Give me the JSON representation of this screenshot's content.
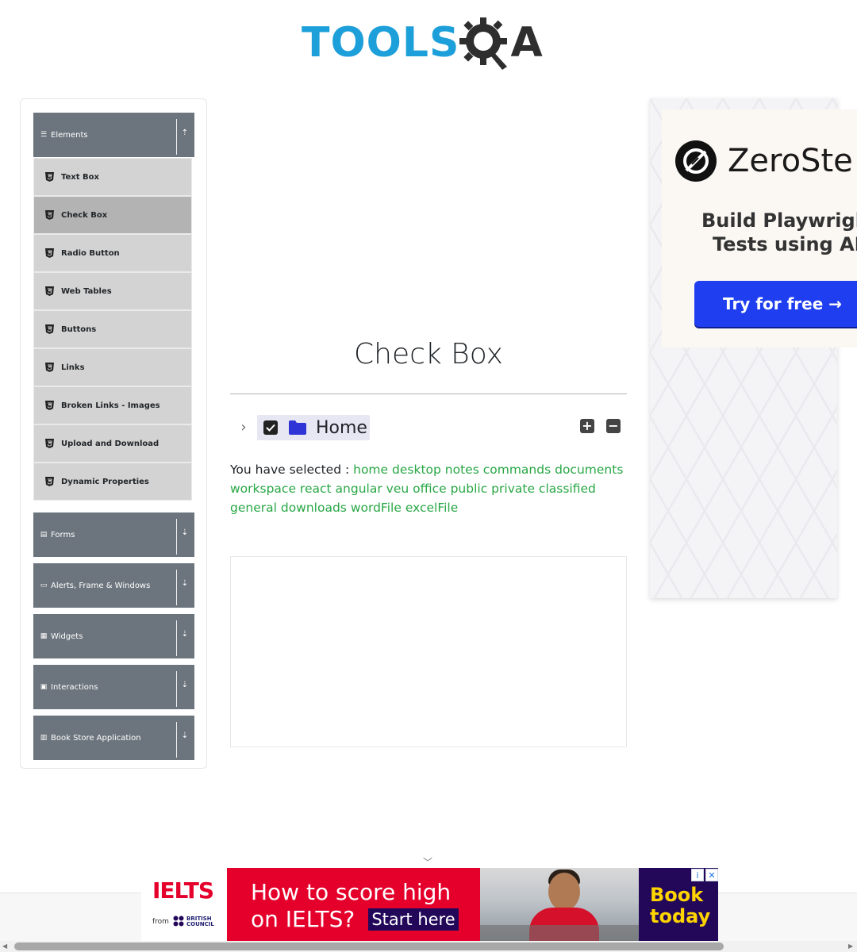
{
  "header": {
    "logo_text": "TOOLSQA",
    "logo_part1": "TOOLS",
    "logo_part2": "A"
  },
  "sidebar": {
    "groups": [
      {
        "label": "Elements",
        "icon": "hamburger-icon",
        "expanded": true
      },
      {
        "label": "Forms",
        "icon": "form-icon",
        "expanded": false
      },
      {
        "label": "Alerts, Frame & Windows",
        "icon": "window-icon",
        "expanded": false
      },
      {
        "label": "Widgets",
        "icon": "widgets-icon",
        "expanded": false
      },
      {
        "label": "Interactions",
        "icon": "interactions-icon",
        "expanded": false
      },
      {
        "label": "Book Store Application",
        "icon": "bookstore-icon",
        "expanded": false
      }
    ],
    "elements_items": [
      {
        "label": "Text Box",
        "active": false
      },
      {
        "label": "Check Box",
        "active": true
      },
      {
        "label": "Radio Button",
        "active": false
      },
      {
        "label": "Web Tables",
        "active": false
      },
      {
        "label": "Buttons",
        "active": false
      },
      {
        "label": "Links",
        "active": false
      },
      {
        "label": "Broken Links - Images",
        "active": false
      },
      {
        "label": "Upload and Download",
        "active": false
      },
      {
        "label": "Dynamic Properties",
        "active": false
      }
    ]
  },
  "main": {
    "title": "Check Box",
    "tree": {
      "root_label": "Home",
      "checked": true,
      "expand_all_label": "+",
      "collapse_all_label": "−"
    },
    "result": {
      "prefix": "You have selected :",
      "selected": [
        "home",
        "desktop",
        "notes",
        "commands",
        "documents",
        "workspace",
        "react",
        "angular",
        "veu",
        "office",
        "public",
        "private",
        "classified",
        "general",
        "downloads",
        "wordFile",
        "excelFile"
      ]
    }
  },
  "side_ad": {
    "brand": "ZeroSte",
    "line1": "Build Playwright",
    "line2": "Tests using AI",
    "cta": "Try for free →"
  },
  "bottom_ad": {
    "logo": "IELTS",
    "from": "from",
    "partner_line1": "BRITISH",
    "partner_line2": "COUNCIL",
    "headline1": "How to score high",
    "headline2": "on IELTS?",
    "cta": "Start here",
    "book1": "Book",
    "book2": "today",
    "info_badge": "i",
    "close_badge": "✕"
  },
  "colors": {
    "logo_blue": "#1d9fd9",
    "sidebar_header": "#6c757d",
    "menu_item": "#d3d3d3",
    "menu_active": "#b3b3b3",
    "selected_text": "#28a745",
    "ad_cta": "#1e3ef0",
    "ielts_red": "#e4002b"
  }
}
